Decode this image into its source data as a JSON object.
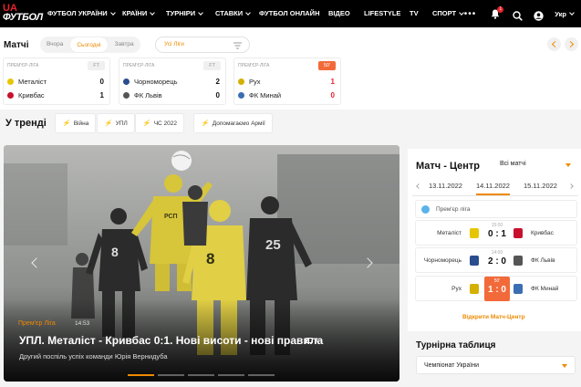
{
  "header": {
    "logo_top": "UA",
    "logo_bottom": "ФУТБОЛ",
    "nav": [
      {
        "label": "ФУТБОЛ УКРАЇНИ",
        "dropdown": true
      },
      {
        "label": "КРАЇНИ",
        "dropdown": true
      },
      {
        "label": "ТУРНІРИ",
        "dropdown": true
      },
      {
        "label": "СТАВКИ",
        "dropdown": true
      },
      {
        "label": "ФУТБОЛ ОНЛАЙН",
        "dropdown": false
      },
      {
        "label": "ВІДЕО",
        "dropdown": false
      },
      {
        "label": "LIFESTYLE",
        "dropdown": false
      },
      {
        "label": "TV",
        "dropdown": false
      },
      {
        "label": "СПОРТ",
        "dropdown": true
      }
    ],
    "more_icon": "•••",
    "notifications_count": "1",
    "lang": "Укр",
    "accent": "#ee8a00",
    "brand_red": "#e8222c"
  },
  "matches_bar": {
    "title": "Матчі",
    "days": [
      "Вчора",
      "Сьогодні",
      "Завтра"
    ],
    "active_day": 1,
    "league_filter": "Усі Ліги",
    "cards": [
      {
        "league": "Прем'єр-Ліга",
        "status": "FT",
        "live": false,
        "home": "Металіст",
        "home_score": "0",
        "home_color": "#e6c600",
        "away": "Кривбас",
        "away_score": "1",
        "away_color": "#c8102e"
      },
      {
        "league": "Прем'єр-Ліга",
        "status": "FT",
        "live": false,
        "home": "Чорноморець",
        "home_score": "2",
        "home_color": "#2a4d8f",
        "away": "ФК Львів",
        "away_score": "0",
        "away_color": "#555555"
      },
      {
        "league": "Прем'єр-Ліга",
        "status": "50'",
        "live": true,
        "home": "Рух",
        "home_score": "1",
        "home_color": "#d4b000",
        "away": "ФК Минай",
        "away_score": "0",
        "away_color": "#3b6db3"
      }
    ]
  },
  "trending": {
    "title": "У тренді",
    "tags": [
      "Війна",
      "УПЛ",
      "ЧС 2022",
      "Допомагаємо Армії"
    ]
  },
  "hero": {
    "category": "Прем'єр Ліга",
    "time": "14:53",
    "title": "УПЛ. Металіст - Кривбас 0:1. Нові висоти - нові правила",
    "comments": "4",
    "subtitle": "Другий поспіль успіх команди Юрія Вернидуба",
    "slides": 5,
    "active_slide": 0
  },
  "match_center": {
    "title": "Матч - Центр",
    "filter": "Всі матчі",
    "dates": [
      "13.11.2022",
      "14.11.2022",
      "15.11.2022"
    ],
    "active_date": 1,
    "league": "Прем'єр ліга",
    "matches": [
      {
        "home": "Металіст",
        "away": "Кривбас",
        "time": "15:00",
        "score": "0 : 1",
        "live": false,
        "home_color": "#e6c600",
        "away_color": "#c8102e"
      },
      {
        "home": "Чорноморець",
        "away": "ФК Львів",
        "time": "14:00",
        "score": "2 : 0",
        "live": false,
        "home_color": "#2a4d8f",
        "away_color": "#555555"
      },
      {
        "home": "Рух",
        "away": "ФК Минай",
        "time": "50'",
        "score": "1 : 0",
        "live": true,
        "home_color": "#d4b000",
        "away_color": "#3b6db3"
      }
    ],
    "open_link": "Відкрити Матч-Центр"
  },
  "standings": {
    "title": "Турнірна таблиця",
    "selected": "Чемпіонат України"
  }
}
